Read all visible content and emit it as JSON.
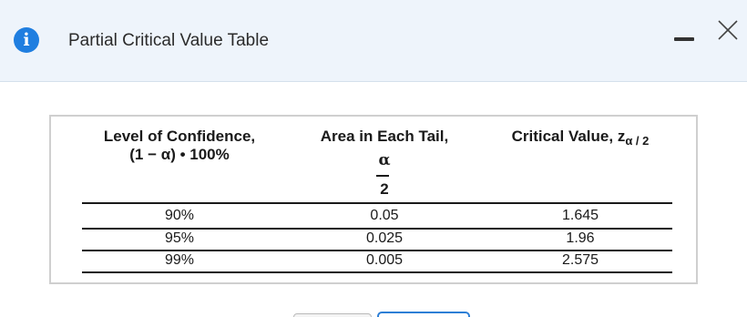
{
  "dialog": {
    "title": "Partial Critical Value Table",
    "info_icon": "info-icon",
    "minimize_icon": "minimize-icon",
    "close_icon": "close-icon"
  },
  "table": {
    "headers": {
      "confidence_line1": "Level of Confidence,",
      "confidence_line2": "(1 − α) • 100%",
      "area_line1": "Area in Each Tail,",
      "area_numerator": "α",
      "area_denominator": "2",
      "critical_main": "Critical Value, z",
      "critical_sub": "α / 2"
    },
    "rows": [
      {
        "confidence": "90%",
        "area": "0.05",
        "critical": "1.645"
      },
      {
        "confidence": "95%",
        "area": "0.025",
        "critical": "1.96"
      },
      {
        "confidence": "99%",
        "area": "0.005",
        "critical": "2.575"
      }
    ]
  }
}
